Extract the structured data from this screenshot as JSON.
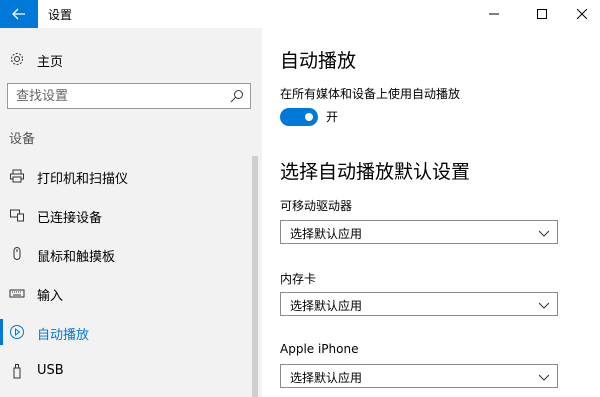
{
  "window": {
    "title": "设置"
  },
  "sidebar": {
    "home_label": "主页",
    "search_placeholder": "查找设置",
    "section_title": "设备",
    "items": [
      {
        "label": "打印机和扫描仪",
        "icon": "printer-icon"
      },
      {
        "label": "已连接设备",
        "icon": "connected-devices-icon"
      },
      {
        "label": "鼠标和触摸板",
        "icon": "mouse-icon"
      },
      {
        "label": "输入",
        "icon": "keyboard-icon"
      },
      {
        "label": "自动播放",
        "icon": "autoplay-icon",
        "active": true
      },
      {
        "label": "USB",
        "icon": "usb-icon"
      }
    ]
  },
  "main": {
    "title": "自动播放",
    "toggle_caption": "在所有媒体和设备上使用自动播放",
    "toggle_state": "开",
    "toggle_on": true,
    "defaults_title": "选择自动播放默认设置",
    "defaults": [
      {
        "label": "可移动驱动器",
        "value": "选择默认应用"
      },
      {
        "label": "内存卡",
        "value": "选择默认应用"
      },
      {
        "label": "Apple iPhone",
        "value": "选择默认应用"
      }
    ]
  },
  "colors": {
    "accent": "#0078d7",
    "sidebar_bg": "#f2f2f2"
  }
}
